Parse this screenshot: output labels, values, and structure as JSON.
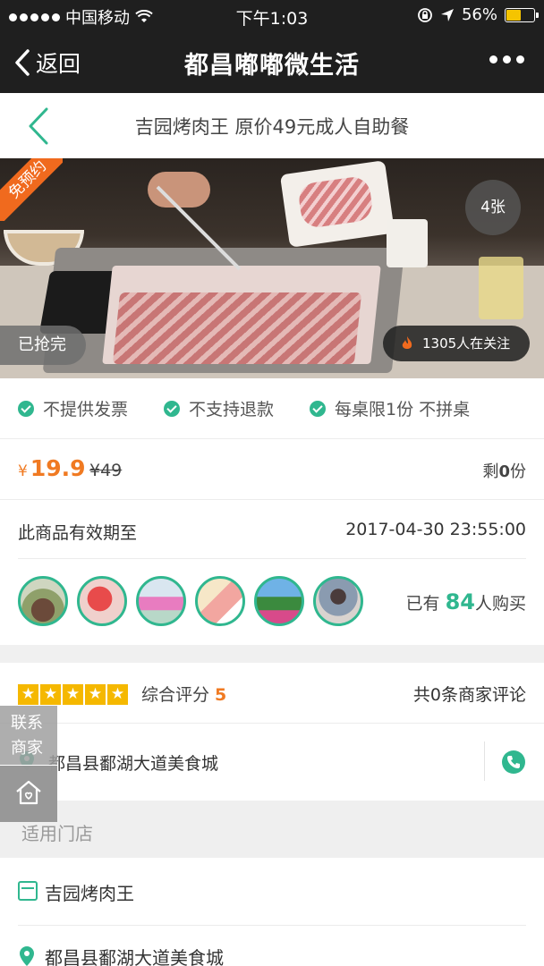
{
  "status_bar": {
    "carrier": "中国移动",
    "time": "下午1:03",
    "battery_percent": "56%",
    "battery_level": 0.56
  },
  "nav": {
    "back_label": "返回",
    "title": "都昌嘟嘟微生活"
  },
  "product": {
    "title": "吉园烤肉王 原价49元成人自助餐"
  },
  "hero": {
    "free_reservation": "免预约",
    "photo_count": "4张",
    "sold_out": "已抢完",
    "followers": "1305人在关注"
  },
  "policies": [
    {
      "label": "不提供发票"
    },
    {
      "label": "不支持退款"
    },
    {
      "label": "每桌限1份 不拼桌"
    }
  ],
  "price": {
    "currency": "¥",
    "current": "19.9",
    "original": "¥49",
    "remain_prefix": "剩",
    "remain_count": "0",
    "remain_suffix": "份"
  },
  "validity": {
    "label": "此商品有效期至",
    "date": "2017-04-30 23:55:00"
  },
  "buyers": {
    "prefix": "已有",
    "count": "84",
    "suffix": "人购买"
  },
  "rating": {
    "label": "综合评分",
    "score": "5",
    "stars": 5,
    "reviews": "共0条商家评论"
  },
  "address": {
    "text": "都昌县鄱湖大道美食城"
  },
  "stores": {
    "header": "适用门店",
    "name": "吉园烤肉王",
    "address": "都昌县鄱湖大道美食城"
  },
  "contact": {
    "label": "联系商家"
  },
  "colors": {
    "accent": "#30b78f",
    "price": "#f07a22",
    "dark_bar": "#1f1f1f"
  }
}
